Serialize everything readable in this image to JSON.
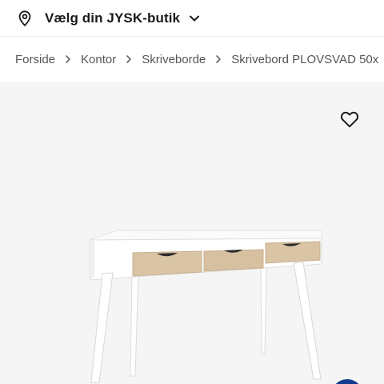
{
  "store_selector": {
    "label": "Vælg din JYSK-butik",
    "icon": "location-pin-icon",
    "chevron": "chevron-down-icon"
  },
  "breadcrumb": {
    "items": [
      "Forside",
      "Kontor",
      "Skriveborde",
      "Skrivebord PLOVSVAD 50x"
    ],
    "separator_icon": "chevron-right-icon"
  },
  "product_image": {
    "favorite_icon": "heart-outline-icon",
    "background": "#f5f5f5",
    "drawer_color": "#d9c4a5",
    "frame_color": "#ffffff"
  },
  "colors": {
    "text": "#1a1a1a",
    "muted": "#555555",
    "accent": "#143c8c"
  }
}
